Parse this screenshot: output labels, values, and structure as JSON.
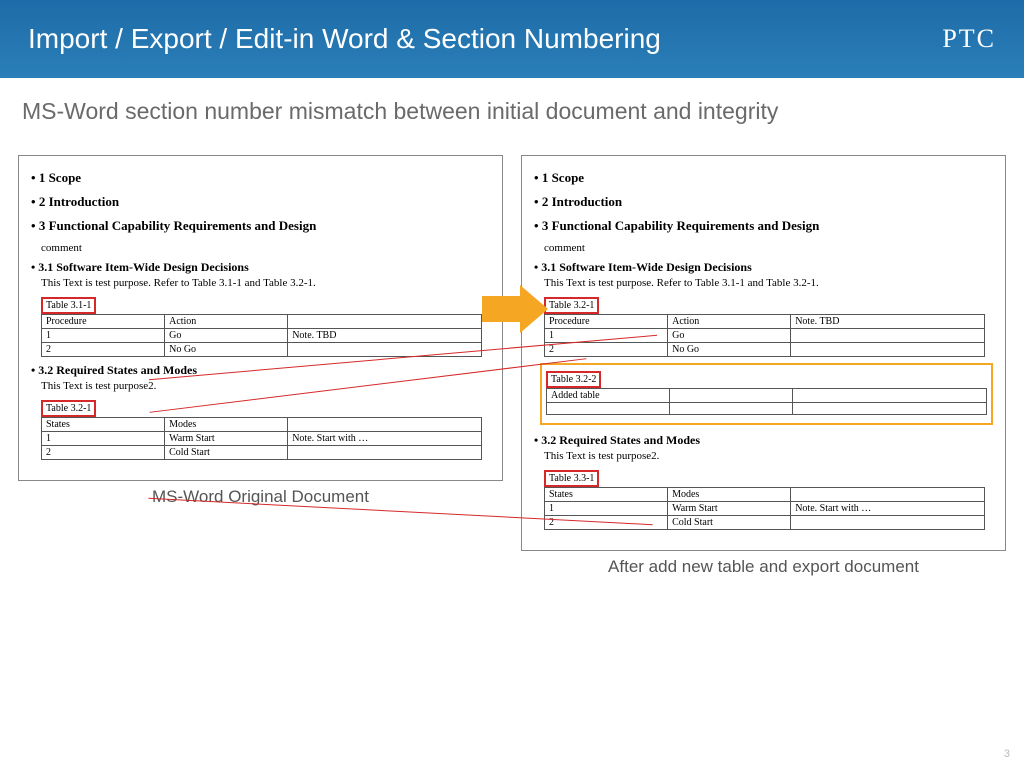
{
  "header": {
    "title": "Import / Export / Edit-in Word & Section Numbering",
    "logo": "PTC"
  },
  "subtitle": "MS-Word section number mismatch between initial document and integrity",
  "left": {
    "caption": "MS-Word Original Document",
    "h1_1": "1   Scope",
    "h1_2": "2   Introduction",
    "h1_3": "3   Functional Capability Requirements and Design",
    "comment": "comment",
    "h2_31": "3.1   Software Item-Wide Design Decisions",
    "p31": "This Text is test purpose. Refer to Table 3.1-1 and Table 3.2-1.",
    "tbl31_cap": "Table 3.1-1",
    "tbl31_h1": "Procedure",
    "tbl31_h2": "Action",
    "tbl31_r1c1": "1",
    "tbl31_r1c2": "Go",
    "tbl31_r1c3": "Note. TBD",
    "tbl31_r2c1": "2",
    "tbl31_r2c2": "No Go",
    "h2_32": "3.2   Required States and Modes",
    "p32": "This Text is test purpose2.",
    "tbl32_cap": "Table 3.2-1",
    "tbl32_h1": "States",
    "tbl32_h2": "Modes",
    "tbl32_r1c1": "1",
    "tbl32_r1c2": "Warm Start",
    "tbl32_r1c3": "Note. Start with …",
    "tbl32_r2c1": "2",
    "tbl32_r2c2": "Cold Start"
  },
  "right": {
    "caption": "After add new table and export document",
    "h1_1": "1   Scope",
    "h1_2": "2   Introduction",
    "h1_3": "3   Functional Capability Requirements and Design",
    "comment": "comment",
    "h2_31": "3.1   Software Item-Wide Design Decisions",
    "p31": "This Text is test purpose. Refer to Table 3.1-1 and Table 3.2-1.",
    "tbl321_cap": "Table 3.2-1",
    "tbl31_h1": "Procedure",
    "tbl31_h2": "Action",
    "tbl31_r1c1": "1",
    "tbl31_r1c2": "Go",
    "tbl31_r1c3": "Note. TBD",
    "tbl31_r2c1": "2",
    "tbl31_r2c2": "No Go",
    "tbl322_cap": "Table 3.2-2",
    "added_label": "Added table",
    "h2_32": "3.2   Required States and Modes",
    "p32": "This Text is test purpose2.",
    "tbl331_cap": "Table 3.3-1",
    "tbl32_h1": "States",
    "tbl32_h2": "Modes",
    "tbl32_r1c1": "1",
    "tbl32_r1c2": "Warm Start",
    "tbl32_r1c3": "Note. Start with …",
    "tbl32_r2c1": "2",
    "tbl32_r2c2": "Cold Start"
  },
  "pagenum": "3"
}
